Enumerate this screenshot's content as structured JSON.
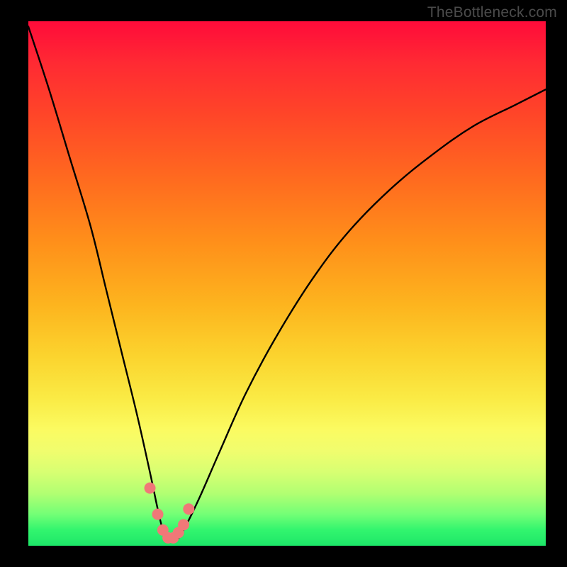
{
  "watermark": "TheBottleneck.com",
  "chart_data": {
    "type": "line",
    "title": "",
    "xlabel": "",
    "ylabel": "",
    "xlim": [
      0,
      100
    ],
    "ylim": [
      0,
      100
    ],
    "series": [
      {
        "name": "bottleneck-curve",
        "x": [
          0,
          4,
          8,
          12,
          15,
          18,
          21,
          23.5,
          25,
          26,
          27,
          28.5,
          30,
          33,
          37,
          42,
          48,
          55,
          62,
          70,
          78,
          86,
          94,
          100
        ],
        "values": [
          99,
          87,
          74,
          61,
          49,
          37,
          25,
          14,
          7,
          3,
          1,
          1,
          3,
          9,
          18,
          29,
          40,
          51,
          60,
          68,
          74.5,
          80,
          84,
          87
        ]
      }
    ],
    "markers": {
      "name": "highlight-dots",
      "color": "#f07878",
      "x": [
        23.5,
        25.0,
        26.0,
        27.0,
        28.0,
        29.0,
        30.0,
        31.0
      ],
      "values": [
        11,
        6,
        3,
        1.5,
        1.5,
        2.5,
        4,
        7
      ]
    },
    "gradient_stops": [
      {
        "pos": 0.0,
        "color": "#ff0b3a"
      },
      {
        "pos": 0.3,
        "color": "#ff6a1f"
      },
      {
        "pos": 0.55,
        "color": "#fdb41e"
      },
      {
        "pos": 0.78,
        "color": "#fbfb62"
      },
      {
        "pos": 0.92,
        "color": "#8fff74"
      },
      {
        "pos": 1.0,
        "color": "#1de668"
      }
    ]
  }
}
